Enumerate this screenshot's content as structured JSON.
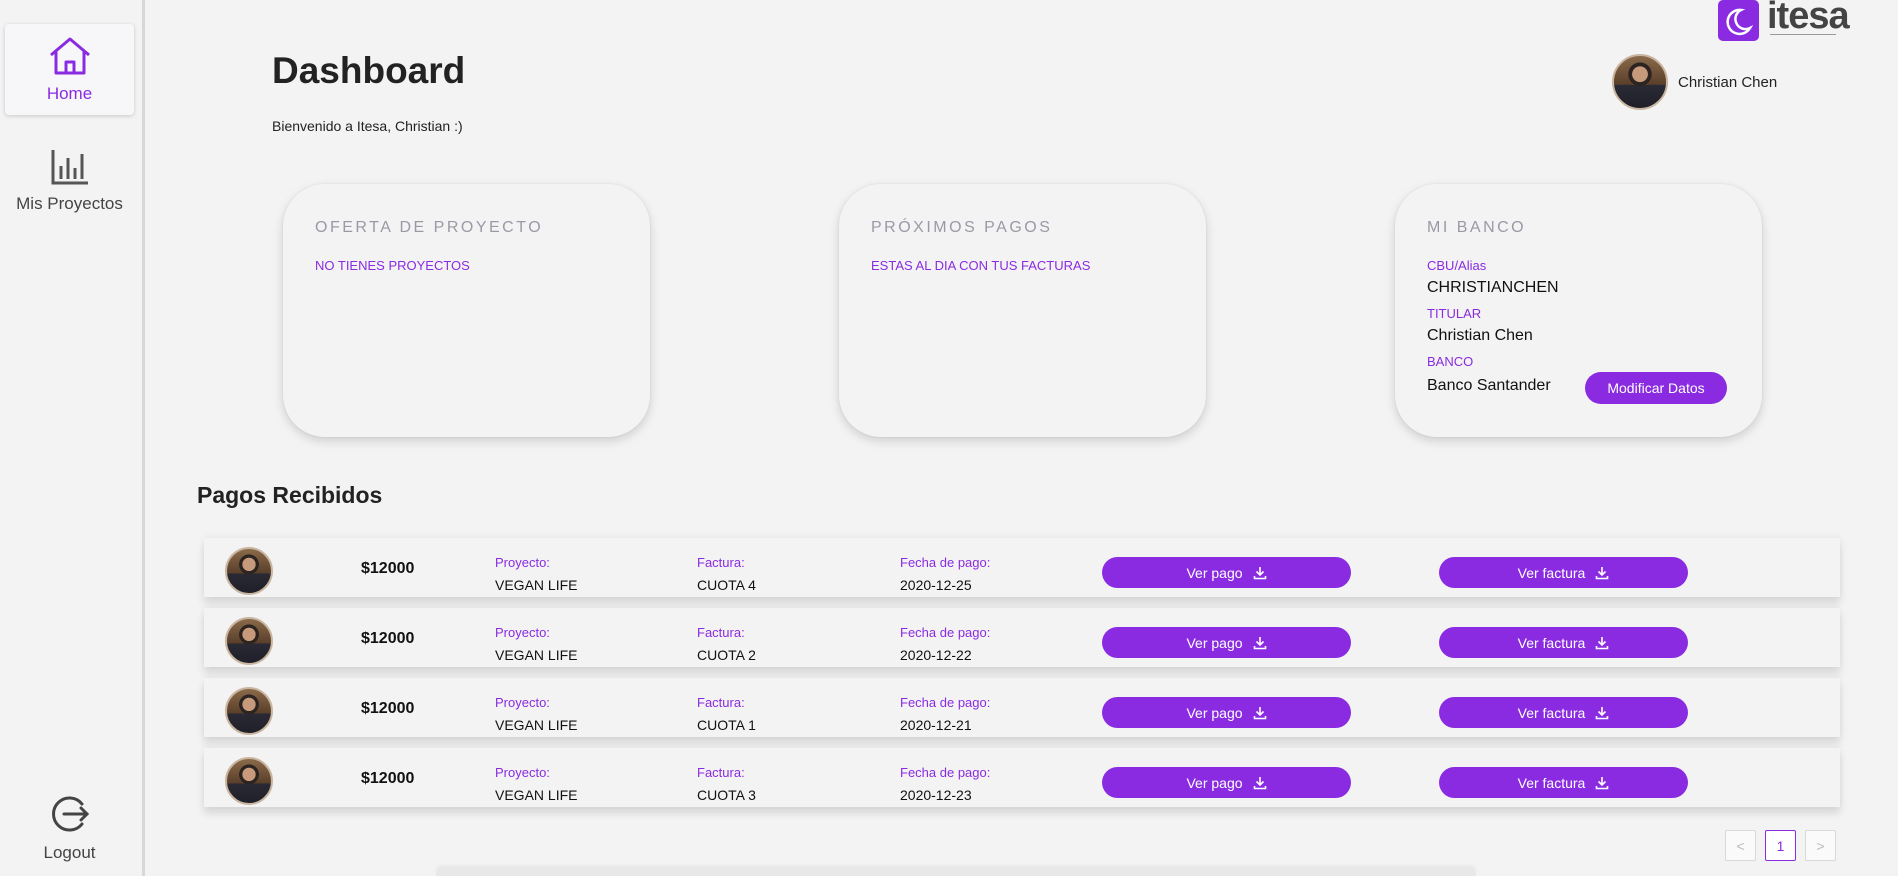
{
  "sidebar": {
    "items": [
      {
        "label": "Home",
        "icon": "home-icon",
        "active": true
      },
      {
        "label": "Mis Proyectos",
        "icon": "bar-chart-icon",
        "active": false
      }
    ],
    "logout": {
      "label": "Logout",
      "icon": "logout-icon"
    }
  },
  "brand": {
    "name": "itesa",
    "accent": "#8a2be2"
  },
  "header": {
    "title": "Dashboard",
    "welcome": "Bienvenido a Itesa, Christian :)",
    "user_name": "Christian Chen"
  },
  "cards": {
    "offer": {
      "title": "OFERTA DE PROYECTO",
      "message": "NO TIENES PROYECTOS"
    },
    "payments": {
      "title": "PRÓXIMOS PAGOS",
      "message": "ESTAS AL DIA CON TUS FACTURAS"
    },
    "bank": {
      "title": "MI BANCO",
      "cbu_label": "CBU/Alias",
      "cbu_value": "CHRISTIANCHEN",
      "holder_label": "TITULAR",
      "holder_value": "Christian Chen",
      "bank_label": "BANCO",
      "bank_value": "Banco Santander",
      "modify_label": "Modificar Datos"
    }
  },
  "received": {
    "title": "Pagos Recibidos",
    "labels": {
      "project": "Proyecto:",
      "invoice": "Factura:",
      "date": "Fecha de pago:",
      "view_payment": "Ver pago",
      "view_invoice": "Ver factura"
    },
    "rows": [
      {
        "amount": "$12000",
        "project": "VEGAN LIFE",
        "invoice": "CUOTA 4",
        "date": "2020-12-25"
      },
      {
        "amount": "$12000",
        "project": "VEGAN LIFE",
        "invoice": "CUOTA 2",
        "date": "2020-12-22"
      },
      {
        "amount": "$12000",
        "project": "VEGAN LIFE",
        "invoice": "CUOTA 1",
        "date": "2020-12-21"
      },
      {
        "amount": "$12000",
        "project": "VEGAN LIFE",
        "invoice": "CUOTA 3",
        "date": "2020-12-23"
      }
    ]
  },
  "pagination": {
    "prev": "<",
    "current": "1",
    "next": ">"
  }
}
